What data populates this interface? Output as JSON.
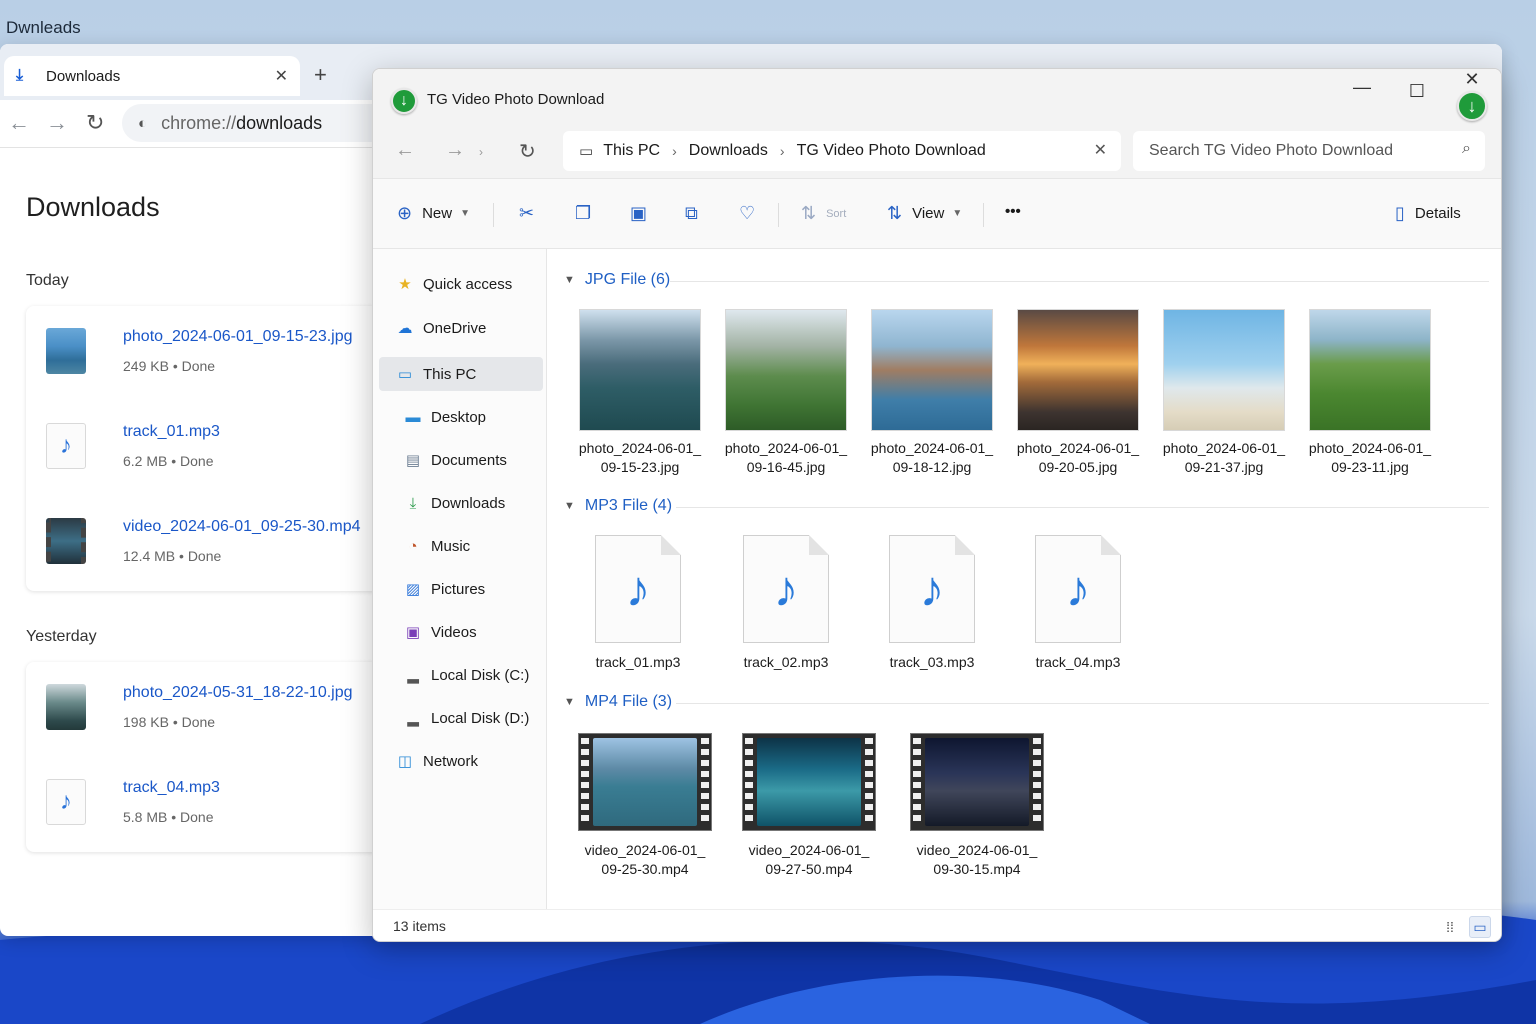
{
  "desktop": {
    "label": "Dwnleads"
  },
  "chrome": {
    "tab_title": "Downloads",
    "tab_close": "✕",
    "new_tab": "+",
    "url_scheme": "chrome://",
    "url_path": "downloads",
    "heading": "Downloads",
    "groups": [
      {
        "label": "Today",
        "items": [
          {
            "name": "photo_2024-06-01_09-15-23.jpg",
            "meta": "249 KB • Done",
            "icon": "photo-icon"
          },
          {
            "name": "track_01.mp3",
            "meta": "6.2 MB • Done",
            "icon": "audio-file-icon"
          },
          {
            "name": "video_2024-06-01_09-25-30.mp4",
            "meta": "12.4 MB • Done",
            "icon": "video-file-icon"
          }
        ]
      },
      {
        "label": "Yesterday",
        "items": [
          {
            "name": "photo_2024-05-31_18-22-10.jpg",
            "meta": "198 KB • Done",
            "icon": "photo-icon"
          },
          {
            "name": "track_04.mp3",
            "meta": "5.8 MB • Done",
            "icon": "audio-file-icon"
          }
        ]
      }
    ]
  },
  "explorer": {
    "title": "TG Video Photo Download",
    "breadcrumb": [
      "This PC",
      "Downloads",
      "TG Video Photo Download"
    ],
    "search_placeholder": "Search TG Video Photo Download",
    "commands": {
      "new": "New",
      "sort": "Sort",
      "view": "View",
      "more": "•••",
      "details": "Details"
    },
    "nav_pane": [
      {
        "label": "Quick access",
        "icon": "star-icon"
      },
      {
        "label": "OneDrive",
        "icon": "cloud-icon"
      },
      {
        "label": "This PC",
        "icon": "monitor-icon",
        "selected": true
      },
      {
        "label": "Desktop",
        "icon": "desktop-icon"
      },
      {
        "label": "Documents",
        "icon": "documents-icon"
      },
      {
        "label": "Downloads",
        "icon": "download-icon"
      },
      {
        "label": "Music",
        "icon": "music-icon"
      },
      {
        "label": "Pictures",
        "icon": "pictures-icon"
      },
      {
        "label": "Videos",
        "icon": "videos-icon"
      },
      {
        "label": "Local Disk (C:)",
        "icon": "disk-icon"
      },
      {
        "label": "Local Disk (D:)",
        "icon": "disk-icon"
      },
      {
        "label": "Network",
        "icon": "network-icon"
      }
    ],
    "groups": {
      "jpg": {
        "header": "JPG File (6)",
        "files": [
          {
            "line1": "photo_2024-06-01_",
            "line2": "09-15-23.jpg"
          },
          {
            "line1": "photo_2024-06-01_",
            "line2": "09-16-45.jpg"
          },
          {
            "line1": "photo_2024-06-01_",
            "line2": "09-18-12.jpg"
          },
          {
            "line1": "photo_2024-06-01_",
            "line2": "09-20-05.jpg"
          },
          {
            "line1": "photo_2024-06-01_",
            "line2": "09-21-37.jpg"
          },
          {
            "line1": "photo_2024-06-01_",
            "line2": "09-23-11.jpg"
          }
        ]
      },
      "mp3": {
        "header": "MP3 File (4)",
        "files": [
          {
            "line1": "track_01.mp3"
          },
          {
            "line1": "track_02.mp3"
          },
          {
            "line1": "track_03.mp3"
          },
          {
            "line1": "track_04.mp3"
          }
        ]
      },
      "mp4": {
        "header": "MP4 File (3)",
        "files": [
          {
            "line1": "video_2024-06-01_",
            "line2": "09-25-30.mp4"
          },
          {
            "line1": "video_2024-06-01_",
            "line2": "09-27-50.mp4"
          },
          {
            "line1": "video_2024-06-01_",
            "line2": "09-30-15.mp4"
          }
        ]
      }
    },
    "status": "13 items"
  }
}
